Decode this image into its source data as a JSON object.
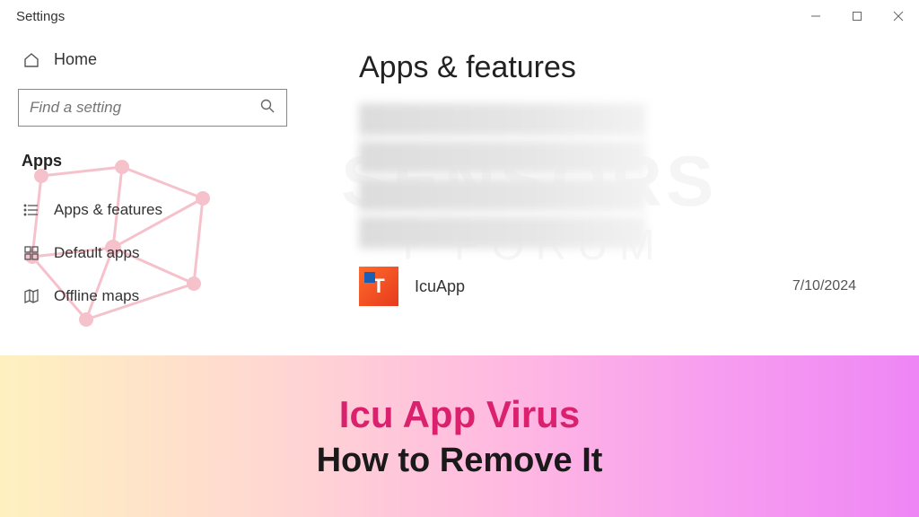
{
  "window": {
    "title": "Settings"
  },
  "sidebar": {
    "home_label": "Home",
    "search_placeholder": "Find a setting",
    "section_label": "Apps",
    "items": [
      {
        "label": "Apps & features"
      },
      {
        "label": "Default apps"
      },
      {
        "label": "Offline maps"
      }
    ]
  },
  "main": {
    "heading": "Apps & features",
    "app": {
      "name": "IcuApp",
      "date": "7/10/2024"
    }
  },
  "watermark": {
    "line1": "SENSORS",
    "line2": "T     FORUM"
  },
  "banner": {
    "title": "Icu App Virus",
    "subtitle": "How to Remove It"
  }
}
